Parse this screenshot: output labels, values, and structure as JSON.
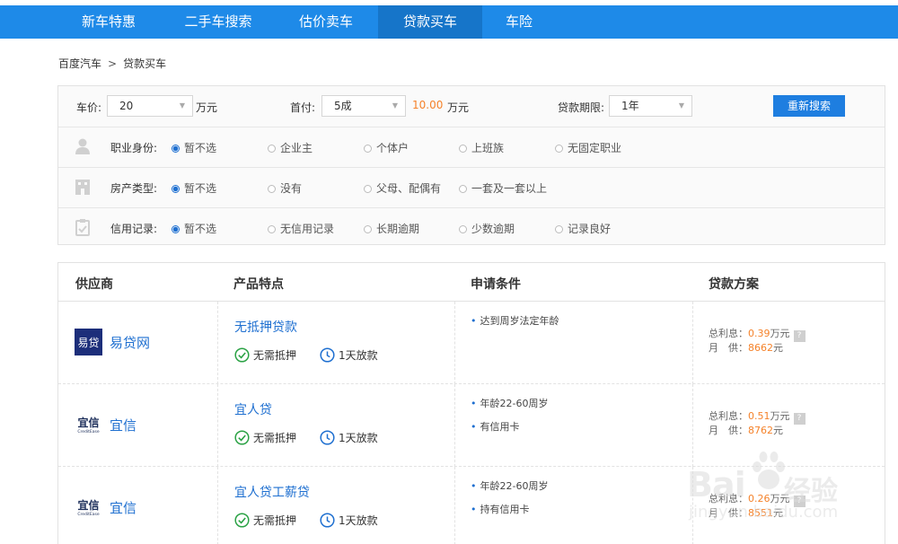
{
  "nav": {
    "items": [
      {
        "label": "新车特惠"
      },
      {
        "label": "二手车搜索"
      },
      {
        "label": "估价卖车"
      },
      {
        "label": "贷款买车",
        "active": true
      },
      {
        "label": "车险"
      }
    ],
    "bg_color": "#1e8ae8",
    "active_color": "#1675c9"
  },
  "breadcrumb": {
    "home": "百度汽车",
    "separator": ">",
    "current": "贷款买车"
  },
  "filter": {
    "price_label": "车价:",
    "price_value": "20",
    "price_unit": "万元",
    "down_label": "首付:",
    "down_value": "5成",
    "down_amount": "10.00",
    "down_unit": "万元",
    "term_label": "贷款期限:",
    "term_value": "1年",
    "search_button": "重新搜索",
    "rows": [
      {
        "icon": "person-icon",
        "label": "职业身份:",
        "options": [
          "暂不选",
          "企业主",
          "个体户",
          "上班族",
          "无固定职业"
        ],
        "selected": "暂不选"
      },
      {
        "icon": "building-icon",
        "label": "房产类型:",
        "options": [
          "暂不选",
          "没有",
          "父母、配偶有",
          "一套及一套以上"
        ],
        "selected": "暂不选"
      },
      {
        "icon": "clipboard-icon",
        "label": "信用记录:",
        "options": [
          "暂不选",
          "无信用记录",
          "长期逾期",
          "少数逾期",
          "记录良好"
        ],
        "selected": "暂不选"
      }
    ]
  },
  "table": {
    "headers": [
      "供应商",
      "产品特点",
      "申请条件",
      "贷款方案"
    ],
    "feature_labels": [
      "无需抵押",
      "1天放款"
    ],
    "plan_labels": {
      "interest": "总利息：",
      "monthly": "月　供：",
      "unit_interest": "万元",
      "unit_monthly": "元"
    },
    "rows": [
      {
        "provider_logo_text": "易贷",
        "provider": "易贷网",
        "product": "无抵押贷款",
        "conditions": [
          "达到周岁法定年龄"
        ],
        "interest": "0.39",
        "monthly": "8662"
      },
      {
        "provider_logo_text": "宜信",
        "provider_logo_sub": "CreditEase",
        "provider": "宜信",
        "product": "宜人贷",
        "conditions": [
          "年龄22-60周岁",
          "有信用卡"
        ],
        "interest": "0.51",
        "monthly": "8762"
      },
      {
        "provider_logo_text": "宜信",
        "provider_logo_sub": "CreditEase",
        "provider": "宜信",
        "product": "宜人贷工薪贷",
        "conditions": [
          "年龄22-60周岁",
          "持有信用卡"
        ],
        "interest": "0.26",
        "monthly": "8551"
      }
    ]
  },
  "watermark": {
    "brand": "Bai",
    "brand_tail": "经验",
    "url": "jingyan.baidu.com"
  },
  "colors": {
    "accent_blue": "#1e6fd0",
    "orange": "#f5822a",
    "green_check": "#2ba245"
  }
}
